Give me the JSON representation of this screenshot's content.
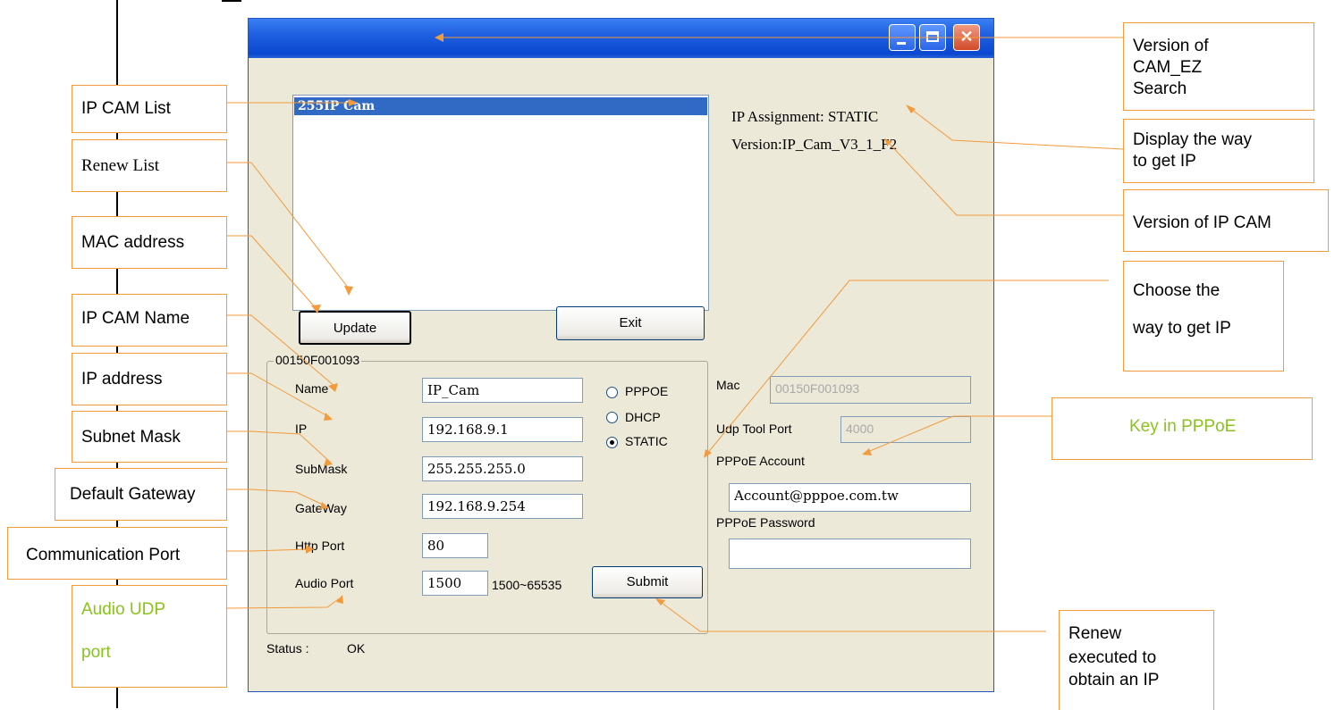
{
  "list": {
    "items": [
      "255IP Cam"
    ]
  },
  "info": {
    "ip_assignment": "IP Assignment: STATIC",
    "version": "Version:IP_Cam_V3_1_F2"
  },
  "buttons": {
    "update": "Update",
    "exit": "Exit",
    "submit": "Submit"
  },
  "group": {
    "legend": "00150F001093",
    "name_label": "Name",
    "name_value": "IP_Cam",
    "ip_label": "IP",
    "ip_value": "192.168.9.1",
    "submask_label": "SubMask",
    "submask_value": "255.255.255.0",
    "gateway_label": "GateWay",
    "gateway_value": "192.168.9.254",
    "http_label": "Http Port",
    "http_value": "80",
    "audio_label": "Audio Port",
    "audio_value": "1500",
    "audio_range": "1500~65535"
  },
  "radios": {
    "pppoe": "PPPOE",
    "dhcp": "DHCP",
    "static": "STATIC",
    "selected": "STATIC"
  },
  "right": {
    "mac_label": "Mac",
    "mac_value": "00150F001093",
    "udp_label": "Udp Tool Port",
    "udp_value": "4000",
    "account_label": "PPPoE Account",
    "account_value": "Account@pppoe.com.tw",
    "password_label": "PPPoE Password",
    "password_value": ""
  },
  "status": {
    "label": "Status :",
    "value": "OK"
  },
  "annotations": {
    "ip_cam_list": "IP CAM List",
    "renew_list": "Renew List",
    "mac_address": "MAC address",
    "ip_cam_name": "IP CAM Name",
    "ip_address": "IP address",
    "subnet_mask": "Subnet Mask",
    "default_gateway": "Default Gateway",
    "communication_port": "Communication Port",
    "audio_udp_1": "Audio UDP",
    "audio_udp_2": "port",
    "version_search_1": "Version of",
    "version_search_2": "CAM_EZ",
    "version_search_3": "Search",
    "display_way_1": "Display the way",
    "display_way_2": "to get IP",
    "version_ipcam": "Version of IP CAM",
    "choose_way_1": "Choose the",
    "choose_way_2": "way to get IP",
    "key_pppoe": "Key in PPPoE",
    "renew_exec_1": "Renew",
    "renew_exec_2": "executed to",
    "renew_exec_3": "obtain an IP"
  },
  "colors": {
    "annotation_border": "#f39a3c",
    "highlight_text": "#8ac31c",
    "titlebar": "#0a48d0",
    "dialog_bg": "#ece9d8"
  }
}
